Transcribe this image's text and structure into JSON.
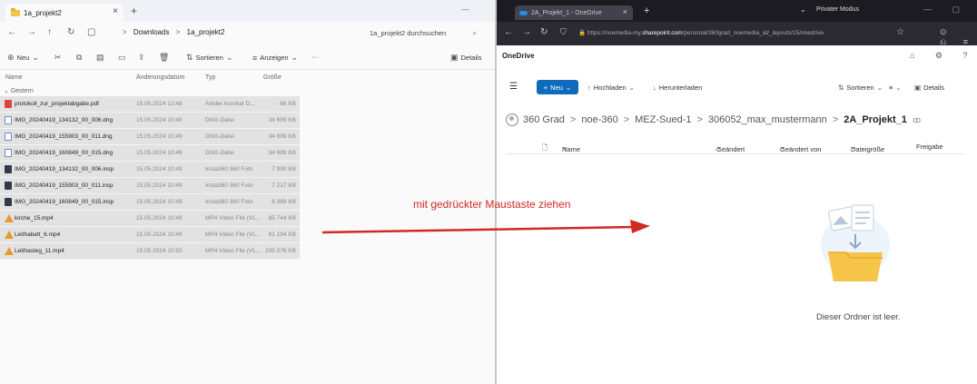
{
  "explorer": {
    "tab_title": "1a_projekt2",
    "tab_close": "×",
    "new_tab": "+",
    "window_controls": "—",
    "nav": {
      "back": "←",
      "forward": "→",
      "up": "↑",
      "refresh": "↻",
      "view": "▢"
    },
    "breadcrumb": [
      "Downloads",
      "1a_projekt2"
    ],
    "breadcrumb_sep": ">",
    "search_placeholder": "1a_projekt2 durchsuchen",
    "toolbar": {
      "new_label": "Neu",
      "sort_label": "Sortieren",
      "view_label": "Anzeigen",
      "more_label": "···",
      "details_label": "Details"
    },
    "columns": {
      "name": "Name",
      "date": "Änderungsdatum",
      "type": "Typ",
      "size": "Größe"
    },
    "group_label": "Gestern",
    "files": [
      {
        "name": "protokoll_zur_projektabgabe.pdf",
        "date": "15.05.2024 12:48",
        "type": "Adobe Acrobat D...",
        "size": "86 KB",
        "icon": "pdf-icon"
      },
      {
        "name": "IMG_20240419_134132_00_006.dng",
        "date": "15.05.2024 10:49",
        "type": "DNG-Datei",
        "size": "34 699 KB",
        "icon": "dng-icon"
      },
      {
        "name": "IMG_20240419_155903_00_011.dng",
        "date": "15.05.2024 10:49",
        "type": "DNG-Datei",
        "size": "34 699 KB",
        "icon": "dng-icon"
      },
      {
        "name": "IMG_20240419_160849_00_015.dng",
        "date": "15.05.2024 10:49",
        "type": "DNG-Datei",
        "size": "34 699 KB",
        "icon": "dng-icon"
      },
      {
        "name": "IMG_20240419_134132_00_006.insp",
        "date": "15.05.2024 10:49",
        "type": "Insta360 360 Foto",
        "size": "7 990 KB",
        "icon": "insp-icon"
      },
      {
        "name": "IMG_20240419_155903_00_011.insp",
        "date": "15.05.2024 10:49",
        "type": "Insta360 360 Foto",
        "size": "7 217 KB",
        "icon": "insp-icon"
      },
      {
        "name": "IMG_20240419_160849_00_015.insp",
        "date": "15.05.2024 10:49",
        "type": "Insta360 360 Foto",
        "size": "8 389 KB",
        "icon": "insp-icon"
      },
      {
        "name": "kirche_15.mp4",
        "date": "15.05.2024 10:49",
        "type": "MP4 Video File (VL...",
        "size": "85 744 KB",
        "icon": "vlc-icon"
      },
      {
        "name": "Leithabett_6.mp4",
        "date": "15.05.2024 10:49",
        "type": "MP4 Video File (VL...",
        "size": "91 194 KB",
        "icon": "vlc-icon"
      },
      {
        "name": "Leithasteg_11.mp4",
        "date": "15.05.2024 10:50",
        "type": "MP4 Video File (VL...",
        "size": "205 076 KB",
        "icon": "vlc-icon"
      }
    ]
  },
  "browser": {
    "tab_title": "2A_Projekt_1 - OneDrive",
    "tab_close": "×",
    "new_tab": "+",
    "tabs_menu": "⌄",
    "private_label": "Privater Modus",
    "window_controls": "— ▢",
    "nav": {
      "back": "←",
      "forward": "→",
      "reload": "↻"
    },
    "url_prefix": "https://noemedia-my.",
    "url_host": "sharepoint.com",
    "url_suffix": "/personal/360grad_noemedia_at/_layouts/15/onedrive.",
    "bookmark": "☆",
    "toolbar_icons": "⊙ ⎌ ≡"
  },
  "onedrive": {
    "brand": "OneDrive",
    "top_icons": "⌂ ⚙ ?",
    "new_label": "Neu",
    "upload_label": "Hochladen",
    "download_label": "Herunterladen",
    "sort_label": "Sortieren",
    "view_label": "≡",
    "details_label": "Details",
    "breadcrumb": [
      "360 Grad",
      "noe-360",
      "MEZ-Sued-1",
      "306052_max_mustermann",
      "2A_Projekt_1"
    ],
    "breadcrumb_sep": ">",
    "share_icon": "ꝏ",
    "columns": {
      "name": "Name",
      "modified": "Geändert",
      "modified_by": "Geändert von",
      "size": "Dateigröße",
      "sharing": "Freigabe"
    },
    "empty_text": "Dieser Ordner ist leer."
  },
  "annotation": {
    "text": "mit gedrückter Maustaste ziehen",
    "color": "#d12a21"
  }
}
